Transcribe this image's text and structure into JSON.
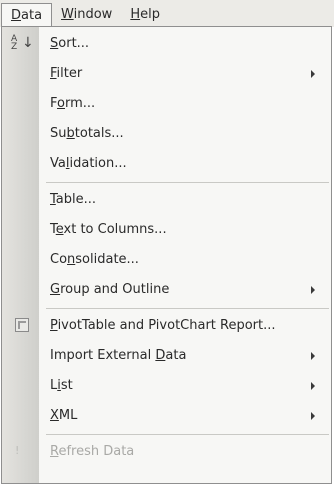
{
  "menubar": {
    "items": [
      {
        "label": "Data",
        "mnemonic": "D",
        "rest": "ata",
        "active": true
      },
      {
        "label": "Window",
        "mnemonic": "W",
        "rest": "indow"
      },
      {
        "label": "Help",
        "mnemonic": "H",
        "rest": "elp"
      }
    ]
  },
  "menu": {
    "items": [
      {
        "pre": "",
        "u": "S",
        "post": "ort...",
        "icon": "sort-ascending-icon",
        "submenu": false
      },
      {
        "pre": "",
        "u": "F",
        "post": "ilter",
        "submenu": true
      },
      {
        "pre": "F",
        "u": "o",
        "post": "rm...",
        "submenu": false
      },
      {
        "pre": "Su",
        "u": "b",
        "post": "totals...",
        "submenu": false
      },
      {
        "pre": "Va",
        "u": "l",
        "post": "idation...",
        "submenu": false
      },
      {
        "pre": "",
        "u": "T",
        "post": "able...",
        "submenu": false
      },
      {
        "pre": "T",
        "u": "e",
        "post": "xt to Columns...",
        "submenu": false
      },
      {
        "pre": "Co",
        "u": "n",
        "post": "solidate...",
        "submenu": false
      },
      {
        "pre": "",
        "u": "G",
        "post": "roup and Outline",
        "submenu": true
      },
      {
        "pre": "",
        "u": "P",
        "post": "ivotTable and PivotChart Report...",
        "icon": "pivottable-icon",
        "submenu": false
      },
      {
        "pre": "Import External ",
        "u": "D",
        "post": "ata",
        "submenu": true
      },
      {
        "pre": "L",
        "u": "i",
        "post": "st",
        "submenu": true
      },
      {
        "pre": "",
        "u": "X",
        "post": "ML",
        "submenu": true
      },
      {
        "pre": "",
        "u": "R",
        "post": "efresh Data",
        "icon": "refresh-icon",
        "submenu": false,
        "disabled": true
      }
    ]
  }
}
